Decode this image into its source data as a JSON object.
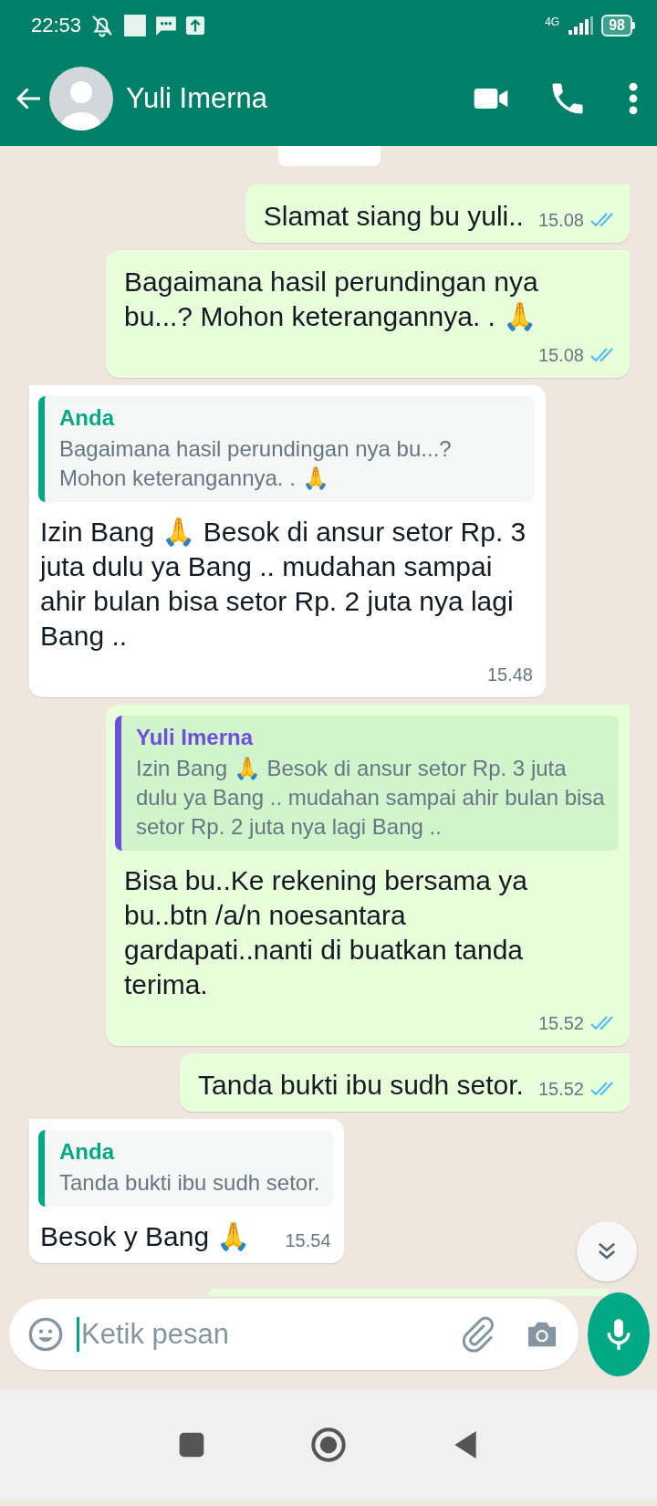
{
  "status_bar": {
    "time": "22:53",
    "network": "4G",
    "battery": "98"
  },
  "header": {
    "contact_name": "Yuli Imerna"
  },
  "messages": [
    {
      "kind": "outgoing",
      "text": "Slamat siang bu yuli..",
      "time": "15.08",
      "read": true
    },
    {
      "kind": "outgoing",
      "text": "Bagaimana hasil perundingan nya bu...? Mohon keterangannya. . 🙏",
      "time": "15.08",
      "read": true
    },
    {
      "kind": "incoming",
      "quote": {
        "author": "Anda",
        "color": "#06a884",
        "text": "Bagaimana hasil perundingan nya bu...? Mohon keterangannya. . 🙏"
      },
      "text": "Izin Bang 🙏 Besok di ansur setor Rp. 3 juta dulu ya Bang .. mudahan sampai ahir bulan bisa setor Rp. 2 juta nya lagi Bang ..",
      "time": "15.48"
    },
    {
      "kind": "outgoing",
      "quote": {
        "author": "Yuli Imerna",
        "color": "#6c4fdc",
        "text": "Izin Bang 🙏 Besok di ansur setor Rp. 3 juta dulu ya Bang .. mudahan sampai ahir bulan bisa setor Rp. 2 juta nya lagi Bang .."
      },
      "text": "Bisa bu..Ke rekening bersama ya bu..btn /a/n noesantara gardapati..nanti di buatkan tanda terima.",
      "time": "15.52",
      "read": true
    },
    {
      "kind": "outgoing",
      "text": "Tanda bukti ibu sudh setor.",
      "time": "15.52",
      "read": true
    },
    {
      "kind": "incoming",
      "quote": {
        "author": "Anda",
        "color": "#06a884",
        "text": "Tanda bukti ibu sudh setor."
      },
      "text": "Besok y Bang 🙏",
      "time": "15.54"
    }
  ],
  "composer": {
    "placeholder": "Ketik pesan"
  }
}
